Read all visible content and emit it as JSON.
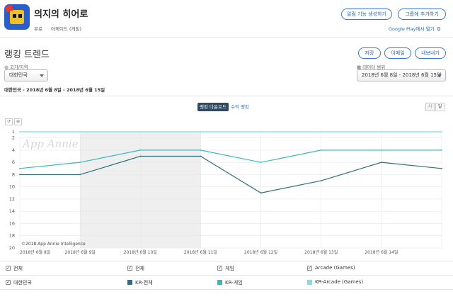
{
  "app": {
    "title": "의지의 히어로",
    "price": "무료",
    "category": "아케이드 (게임)",
    "alert_button": "알림 기능 생성하기",
    "group_button": "그룹에 추가하기",
    "google_play_link": "Google Play에서 열기"
  },
  "section": {
    "title": "랭킹 트렌드",
    "save_button": "저장",
    "email_button": "이메일",
    "export_button": "내보내기",
    "country_label": "국가/지역",
    "country_value": "대한민국",
    "date_label": "데이터 범위",
    "date_value": "2018년 6월 8일 - 2018년 6월 15일",
    "subtitle": "대한민국 - 2018년 6월 8일 - 2018년 6월 15일"
  },
  "toggle": {
    "download_rank": "랭킹 다운로드",
    "revenue_rank": "수익 랭킹",
    "hourly": "시",
    "daily": "일"
  },
  "chart_data": {
    "type": "line",
    "watermark": "App Annie",
    "copyright": "©2018 App Annie Intelligence",
    "x": [
      "2018년 6월 8일",
      "2018년 6월 9일",
      "2018년 6월 10일",
      "2018년 6월 11일",
      "2018년 6월 12일",
      "2018년 6월 13일",
      "2018년 6월 14일",
      "2018년 6월 15일"
    ],
    "x_tick_labels": [
      "2018년 6월 8일",
      "2018년 6월 9일",
      "2018년 6월 10일",
      "2018년 6월 11일",
      "2018년 6월 12일",
      "2018년 6월 13일",
      "2018년 6월 14일"
    ],
    "ylim": [
      1,
      20
    ],
    "y_inverted": true,
    "y_ticks": [
      1,
      2,
      4,
      6,
      8,
      10,
      12,
      14,
      16,
      18,
      20
    ],
    "weekend_band": [
      "2018년 6월 9일",
      "2018년 6월 11일"
    ],
    "series": [
      {
        "name": "KR-전체",
        "color": "#2f6f7a",
        "values": [
          8,
          8,
          5,
          5,
          11,
          9,
          6,
          7
        ]
      },
      {
        "name": "KR-게임",
        "color": "#3ab8be",
        "values": [
          7,
          6,
          4,
          4,
          6,
          4,
          4,
          4
        ]
      },
      {
        "name": "KR-Arcade (Games)",
        "color": "#8fd8e0",
        "values": [
          1,
          1,
          1,
          1,
          1,
          1,
          1,
          1
        ]
      }
    ]
  },
  "legend": {
    "headers": [
      "전체",
      "전체",
      "게임",
      "Arcade (Games)"
    ],
    "country": "대한민국"
  }
}
